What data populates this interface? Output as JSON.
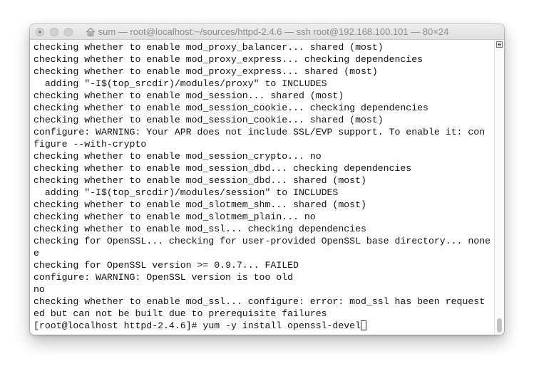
{
  "window": {
    "title": "sum — root@localhost:~/sources/httpd-2.4.6 — ssh root@192.168.100.101 — 80×24"
  },
  "icons": {
    "close": "close-icon",
    "minimize": "minimize-icon",
    "zoom": "zoom-icon",
    "home": "home-icon",
    "scrollbar_menu": "menu-icon"
  },
  "colors": {
    "background": "#ffffff",
    "text": "#111111",
    "title_text": "#8c8c8c"
  },
  "terminal": {
    "lines": [
      "checking whether to enable mod_proxy_balancer... shared (most)",
      "checking whether to enable mod_proxy_express... checking dependencies",
      "checking whether to enable mod_proxy_express... shared (most)",
      "  adding \"-I$(top_srcdir)/modules/proxy\" to INCLUDES",
      "checking whether to enable mod_session... shared (most)",
      "checking whether to enable mod_session_cookie... checking dependencies",
      "checking whether to enable mod_session_cookie... shared (most)",
      "configure: WARNING: Your APR does not include SSL/EVP support. To enable it: con",
      "figure --with-crypto",
      "checking whether to enable mod_session_crypto... no",
      "checking whether to enable mod_session_dbd... checking dependencies",
      "checking whether to enable mod_session_dbd... shared (most)",
      "  adding \"-I$(top_srcdir)/modules/session\" to INCLUDES",
      "checking whether to enable mod_slotmem_shm... shared (most)",
      "checking whether to enable mod_slotmem_plain... no",
      "checking whether to enable mod_ssl... checking dependencies",
      "checking for OpenSSL... checking for user-provided OpenSSL base directory... none",
      "e",
      "checking for OpenSSL version >= 0.9.7... FAILED",
      "configure: WARNING: OpenSSL version is too old",
      "no",
      "checking whether to enable mod_ssl... configure: error: mod_ssl has been request",
      "ed but can not be built due to prerequisite failures"
    ],
    "prompt": "[root@localhost httpd-2.4.6]# yum -y install openssl-devel"
  }
}
